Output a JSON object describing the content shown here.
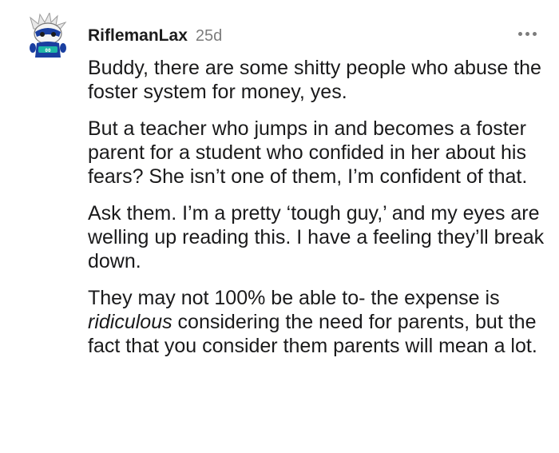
{
  "comment": {
    "author": "RiflemanLax",
    "age": "25d",
    "avatar_icon": "snoo-avatar-icon",
    "more_icon": "more-options-icon",
    "paragraphs": [
      {
        "text": "Buddy, there are some shitty people who abuse the foster system for money, yes."
      },
      {
        "text": "But a teacher who jumps in and becomes a foster parent for a student who confided in her about his fears? She isn’t one of them, I’m confident of that."
      },
      {
        "text": "Ask them. I’m a pretty ‘tough guy,’ and my eyes are welling up reading this. I have a feeling they’ll break down."
      },
      {
        "before": "They may not 100% be able to- the expense is ",
        "emphasis": "ridiculous",
        "after": " considering the need for parents, but the fact that you consider them parents will mean a lot."
      }
    ]
  },
  "colors": {
    "username": "#1c1c1c",
    "timestamp": "#7c7c7c",
    "body_text": "#1a1a1b",
    "avatar_blue": "#1a3fa0",
    "avatar_teal": "#1fb8a6"
  }
}
